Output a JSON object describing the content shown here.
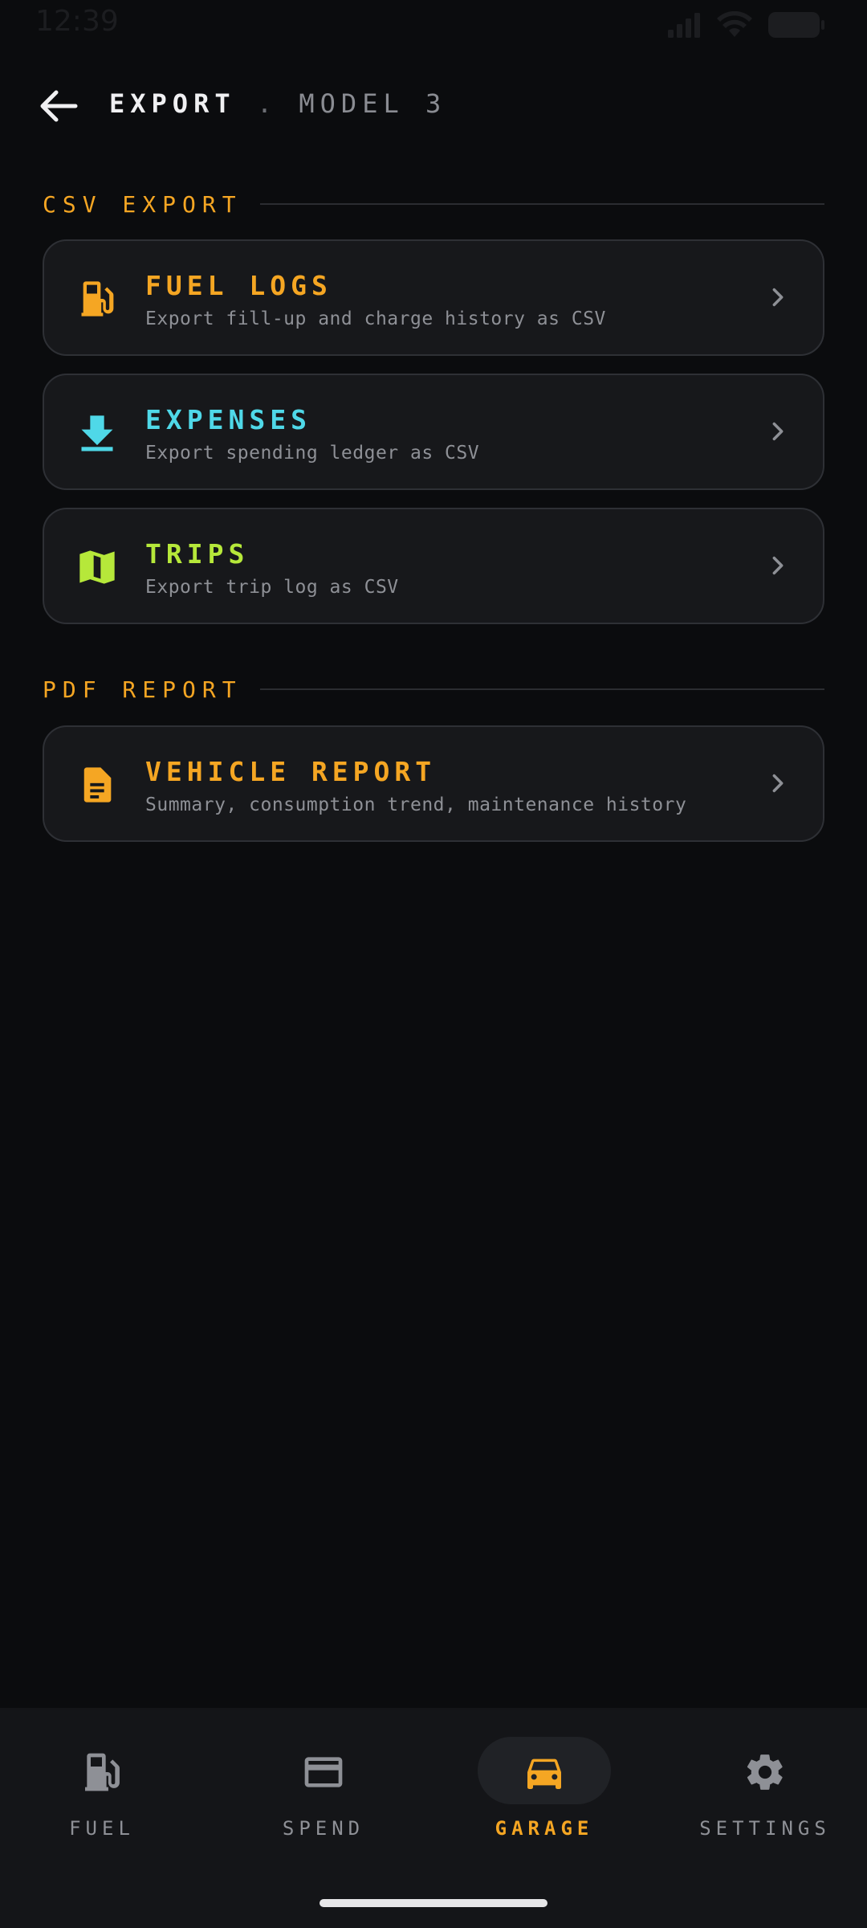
{
  "status_bar": {
    "time": "12:39"
  },
  "header": {
    "title": "EXPORT",
    "separator": ".",
    "subtitle": "MODEL 3"
  },
  "sections": [
    {
      "label": "CSV EXPORT"
    },
    {
      "label": "PDF REPORT"
    }
  ],
  "cards": [
    {
      "title": "FUEL LOGS",
      "description": "Export fill-up and charge history as CSV",
      "icon": "fuel-pump-icon",
      "color": "#f5a623"
    },
    {
      "title": "EXPENSES",
      "description": "Export spending ledger as CSV",
      "icon": "download-icon",
      "color": "#4fd8e8"
    },
    {
      "title": "TRIPS",
      "description": "Export trip log as CSV",
      "icon": "map-icon",
      "color": "#b6e83a"
    },
    {
      "title": "VEHICLE REPORT",
      "description": "Summary, consumption trend, maintenance history",
      "icon": "document-icon",
      "color": "#f5a623"
    }
  ],
  "nav": [
    {
      "label": "FUEL",
      "icon": "fuel-pump-icon",
      "active": false
    },
    {
      "label": "SPEND",
      "icon": "credit-card-icon",
      "active": false
    },
    {
      "label": "GARAGE",
      "icon": "car-icon",
      "active": true
    },
    {
      "label": "SETTINGS",
      "icon": "gear-icon",
      "active": false
    }
  ],
  "colors": {
    "accent": "#f5a623",
    "background": "#0b0c0e",
    "card": "#17181b"
  }
}
